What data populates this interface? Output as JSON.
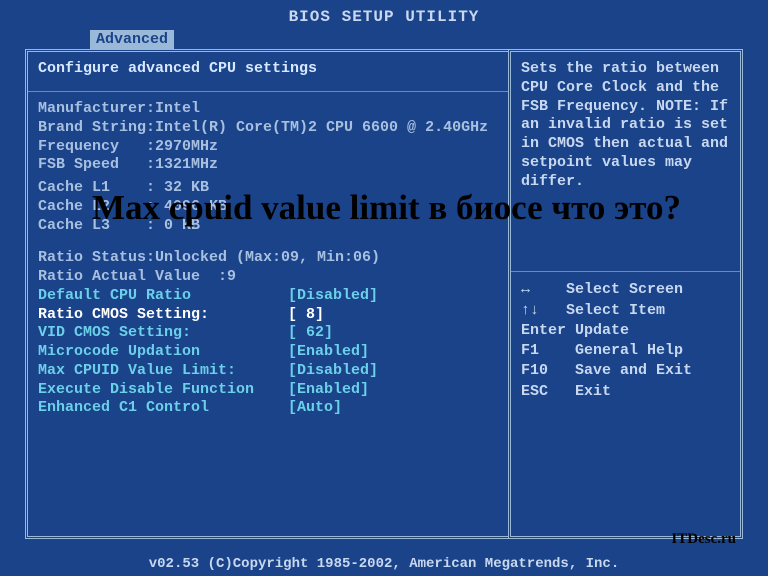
{
  "title": "BIOS SETUP UTILITY",
  "tab": "Advanced",
  "section_title": "Configure advanced CPU settings",
  "info": {
    "manufacturer": "Manufacturer:Intel",
    "brand": "Brand String:Intel(R) Core(TM)2 CPU 6600 @ 2.40GHz",
    "frequency": "Frequency   :2970MHz",
    "fsb": "FSB Speed   :1321MHz",
    "l1": "Cache L1    : 32 KB",
    "l2": "Cache L2    : 4096 KB",
    "l3": "Cache L3    : 0 KB",
    "ratio_status": "Ratio Status:Unlocked (Max:09, Min:06)",
    "ratio_actual": "Ratio Actual Value  :9"
  },
  "settings": [
    {
      "label": "Default CPU Ratio",
      "value": "[Disabled]",
      "style": "cyan"
    },
    {
      "label": "  Ratio CMOS Setting:",
      "value": "[ 8]",
      "style": "white"
    },
    {
      "label": "  VID CMOS Setting:",
      "value": "[ 62]",
      "style": "cyan"
    },
    {
      "label": "Microcode Updation",
      "value": "[Enabled]",
      "style": "cyan"
    },
    {
      "label": "Max CPUID Value Limit:",
      "value": "[Disabled]",
      "style": "cyan"
    },
    {
      "label": "Execute Disable Function",
      "value": "[Enabled]",
      "style": "cyan"
    },
    {
      "label": "Enhanced C1 Control",
      "value": "[Auto]",
      "style": "cyan"
    }
  ],
  "help": "Sets the ratio between CPU Core Clock and the FSB Frequency.\nNOTE: If an invalid ratio is set in CMOS then actual and setpoint values may differ.",
  "hints": [
    "↔    Select Screen",
    "↑↓   Select Item",
    "Enter Update",
    "F1    General Help",
    "F10   Save and Exit",
    "ESC   Exit"
  ],
  "footer": "v02.53 (C)Copyright 1985-2002, American Megatrends, Inc.",
  "overlay": "Max cpuid value limit в биосе что это?",
  "watermark": "ITDesc.ru"
}
